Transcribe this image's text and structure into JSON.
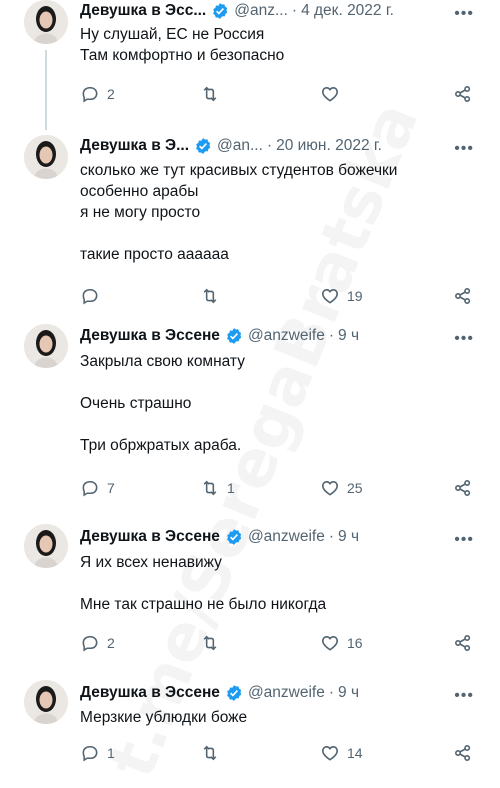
{
  "author": {
    "name": "Девушка в Эссене",
    "handle": "@anzweife"
  },
  "watermark": "t.me/SeregaBratska",
  "tweets": [
    {
      "name": "Девушка в Эсс...",
      "handle": "@anz...",
      "time": "4 дек. 2022 г.",
      "lines": [
        "Ну слушай, ЕС не Россия",
        "Там комфортно и безопасно"
      ],
      "replies": "2",
      "retweets": "",
      "likes": ""
    },
    {
      "name": "Девушка в Э...",
      "handle": "@an...",
      "time": "20 июн. 2022 г.",
      "lines": [
        "сколько же тут красивых студентов божечки",
        "особенно арабы",
        "я не могу просто",
        "",
        "такие просто аааааа"
      ],
      "replies": "",
      "retweets": "",
      "likes": "19"
    },
    {
      "name": "Девушка в Эссене",
      "handle": "@anzweife",
      "time": "9 ч",
      "lines": [
        "Закрыла свою комнату",
        "",
        "Очень страшно",
        "",
        "Три обржратых араба."
      ],
      "replies": "7",
      "retweets": "1",
      "likes": "25"
    },
    {
      "name": "Девушка в Эссене",
      "handle": "@anzweife",
      "time": "9 ч",
      "lines": [
        "Я их всех ненавижу",
        "",
        "Мне так страшно не было никогда"
      ],
      "replies": "2",
      "retweets": "",
      "likes": "16"
    },
    {
      "name": "Девушка в Эссене",
      "handle": "@anzweife",
      "time": "9 ч",
      "lines": [
        "Мерзкие ублюдки боже"
      ],
      "replies": "1",
      "retweets": "",
      "likes": "14"
    }
  ],
  "icons": {
    "reply": "reply-icon",
    "retweet": "retweet-icon",
    "like": "heart-icon",
    "share": "share-icon",
    "verified": "verified-badge-icon",
    "more": "more-options-icon"
  },
  "colors": {
    "verified": "#1d9bf0",
    "muted": "#536471",
    "text": "#0f1419",
    "thread_line": "#cfd9de"
  }
}
